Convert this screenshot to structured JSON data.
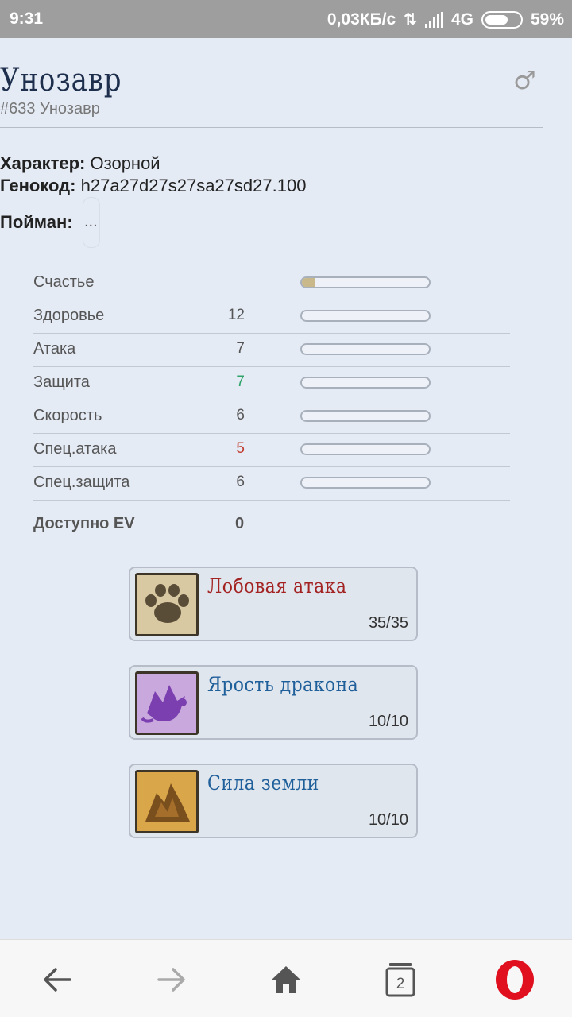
{
  "status_bar": {
    "time": "9:31",
    "network_speed": "0,03КБ/с",
    "network_type": "4G",
    "battery": "59%",
    "icons": [
      "data-transfer-icon",
      "signal-icon",
      "battery-icon"
    ]
  },
  "pokemon": {
    "name": "Унозавр",
    "subtitle": "#633 Унозавр",
    "gender_icon": "male-icon",
    "character_label": "Характер:",
    "character_value": "Озорной",
    "genocode_label": "Генокод:",
    "genocode_value": "h27a27d27s27sa27sd27.100",
    "caught_label": "Пойман:",
    "caught_value": "..."
  },
  "stats": [
    {
      "label": "Счастье",
      "value": "",
      "bar_fill": 0.1,
      "modifier": "none"
    },
    {
      "label": "Здоровье",
      "value": "12",
      "bar_fill": 0,
      "modifier": "none"
    },
    {
      "label": "Атака",
      "value": "7",
      "bar_fill": 0,
      "modifier": "none"
    },
    {
      "label": "Защита",
      "value": "7",
      "bar_fill": 0,
      "modifier": "up"
    },
    {
      "label": "Скорость",
      "value": "6",
      "bar_fill": 0,
      "modifier": "none"
    },
    {
      "label": "Спец.атака",
      "value": "5",
      "bar_fill": 0,
      "modifier": "down"
    },
    {
      "label": "Спец.защита",
      "value": "6",
      "bar_fill": 0,
      "modifier": "none"
    }
  ],
  "ev": {
    "label": "Доступно EV",
    "value": "0"
  },
  "moves": [
    {
      "name": "Лобовая атака",
      "pp": "35/35",
      "icon": "paw-icon",
      "color": "#a32222"
    },
    {
      "name": "Ярость дракона",
      "pp": "10/10",
      "icon": "dragon-icon",
      "color": "#1f5f9a"
    },
    {
      "name": "Сила земли",
      "pp": "10/10",
      "icon": "rock-icon",
      "color": "#1f5f9a"
    }
  ],
  "navbar": {
    "tabs_count": "2",
    "icons": [
      "back-arrow-icon",
      "forward-arrow-icon",
      "home-icon",
      "tabs-icon",
      "opera-icon"
    ]
  },
  "colors": {
    "background": "#e5ebf5",
    "accent_up": "#2fa36a",
    "accent_down": "#c0392b",
    "opera_red": "#e0101e"
  }
}
